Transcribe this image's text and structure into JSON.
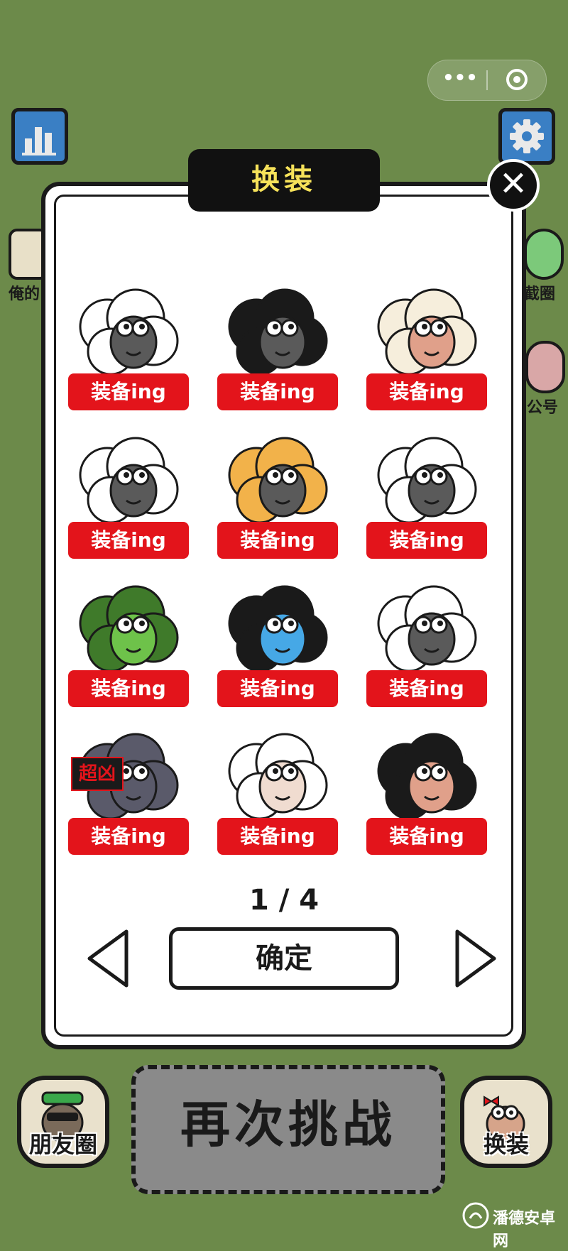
{
  "capsule": {
    "menu_icon": "more-dots-icon",
    "close_icon": "target-circle-icon"
  },
  "top_left": {
    "icon": "bar-chart-icon"
  },
  "top_right": {
    "icon": "gear-icon"
  },
  "side_left": {
    "label": "俺的"
  },
  "side_right_top": {
    "label": "截圈"
  },
  "side_right_mid": {
    "label": "公号"
  },
  "dialog": {
    "title": "换装",
    "close_icon": "close-icon",
    "items": [
      {
        "skin": "white-classic-sheep",
        "label": "装备ing"
      },
      {
        "skin": "black-ram-mask-sheep",
        "label": "装备ing"
      },
      {
        "skin": "party-hat-sheep",
        "label": "装备ing"
      },
      {
        "skin": "wolf-scroll-sheep",
        "label": "装备ing"
      },
      {
        "skin": "burger-sheep",
        "label": "装备ing"
      },
      {
        "skin": "headband-sheep",
        "label": "装备ing"
      },
      {
        "skin": "turtle-shell-sheep",
        "label": "装备ing"
      },
      {
        "skin": "zombie-talisman-sheep",
        "label": "装备ing"
      },
      {
        "skin": "knight-helmet-sheep",
        "label": "装备ing"
      },
      {
        "skin": "fierce-wolf-sheep",
        "label": "装备ing",
        "sign": "超凶"
      },
      {
        "skin": "vampire-sheep",
        "label": "装备ing"
      },
      {
        "skin": "ram-horns-sheep",
        "label": "装备ing"
      }
    ],
    "pager": "1 / 4",
    "confirm_label": "确定",
    "prev_icon": "triangle-left-icon",
    "next_icon": "triangle-right-icon"
  },
  "bottom": {
    "moments_label": "朋友圈",
    "retry_label": "再次挑战",
    "dress_label": "换装"
  },
  "watermark": "潘德安卓网",
  "colors": {
    "background": "#6c8a4a",
    "equip_red": "#e3141b",
    "title_yellow": "#f6e25a"
  }
}
